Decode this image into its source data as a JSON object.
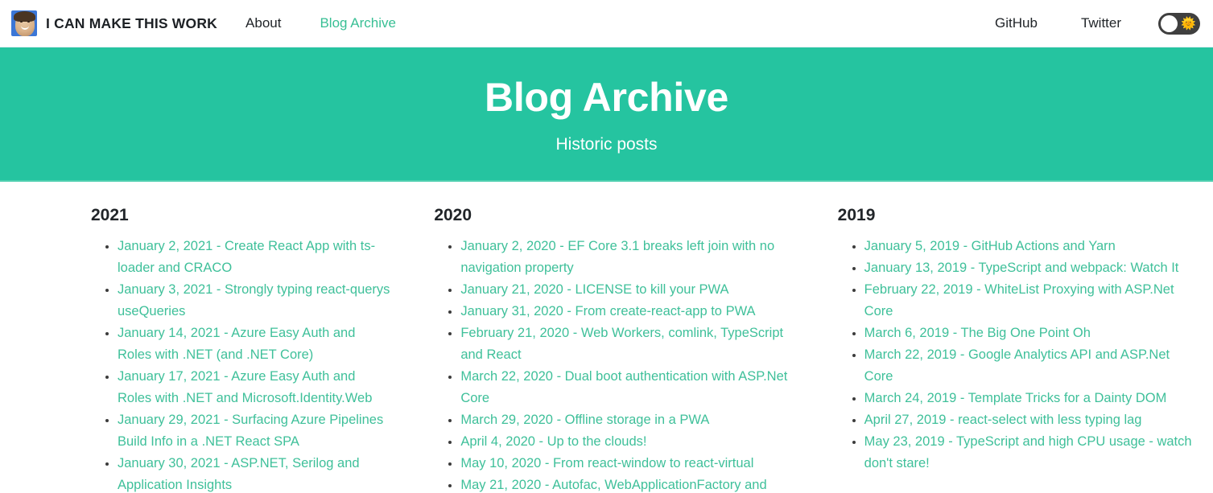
{
  "navbar": {
    "brand": "I CAN MAKE THIS WORK",
    "avatar_icon": "avatar-photo-icon",
    "links": [
      {
        "label": "About",
        "active": false
      },
      {
        "label": "Blog Archive",
        "active": true
      }
    ],
    "right_links": [
      {
        "label": "GitHub"
      },
      {
        "label": "Twitter"
      }
    ],
    "theme_toggle": {
      "state": "light",
      "emoji": "🌞",
      "icon": "sun-icon"
    },
    "accent_color": "#38bf94",
    "text_color": "#212529",
    "border_color": "#e3eef4"
  },
  "hero": {
    "title": "Blog Archive",
    "subtitle": "Historic posts",
    "background_color": "#25c4a0",
    "text_color": "#ffffff"
  },
  "link_color": "#3fc09a",
  "columns": [
    {
      "year": "2021",
      "posts": [
        "January 2, 2021 - Create React App with ts-loader and CRACO",
        "January 3, 2021 - Strongly typing react-querys useQueries",
        "January 14, 2021 - Azure Easy Auth and Roles with .NET (and .NET Core)",
        "January 17, 2021 - Azure Easy Auth and Roles with .NET and Microsoft.Identity.Web",
        "January 29, 2021 - Surfacing Azure Pipelines Build Info in a .NET React SPA",
        "January 30, 2021 - ASP.NET, Serilog and Application Insights"
      ]
    },
    {
      "year": "2020",
      "posts": [
        "January 2, 2020 - EF Core 3.1 breaks left join with no navigation property",
        "January 21, 2020 - LICENSE to kill your PWA",
        "January 31, 2020 - From create-react-app to PWA",
        "February 21, 2020 - Web Workers, comlink, TypeScript and React",
        "March 22, 2020 - Dual boot authentication with ASP.Net Core",
        "March 29, 2020 - Offline storage in a PWA",
        "April 4, 2020 - Up to the clouds!",
        "May 10, 2020 - From react-window to react-virtual",
        "May 21, 2020 - Autofac, WebApplicationFactory and"
      ]
    },
    {
      "year": "2019",
      "posts": [
        "January 5, 2019 - GitHub Actions and Yarn",
        "January 13, 2019 - TypeScript and webpack: Watch It",
        "February 22, 2019 - WhiteList Proxying with ASP.Net Core",
        "March 6, 2019 - The Big One Point Oh",
        "March 22, 2019 - Google Analytics API and ASP.Net Core",
        "March 24, 2019 - Template Tricks for a Dainty DOM",
        "April 27, 2019 - react-select with less typing lag",
        "May 23, 2019 - TypeScript and high CPU usage - watch don't stare!"
      ]
    }
  ]
}
